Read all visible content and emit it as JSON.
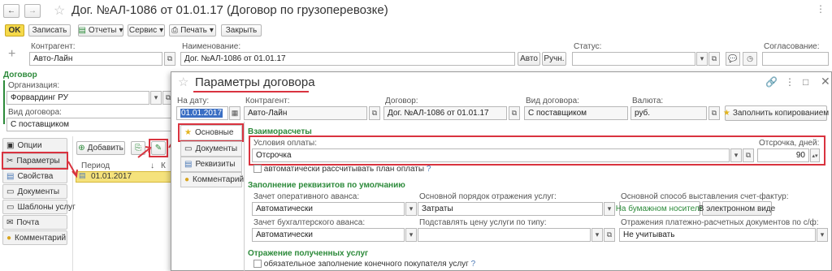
{
  "main": {
    "title": "Дог. №АЛ-1086 от 01.01.17 (Договор по грузоперевозке)",
    "toolbar": {
      "ok": "OK",
      "save": "Записать",
      "reports": "Отчеты",
      "service": "Сервис",
      "print": "Печать",
      "close": "Закрыть"
    },
    "fields": {
      "kontragent_label": "Контрагент:",
      "kontragent": "Авто-Лайн",
      "name_label": "Наименование:",
      "name": "Дог. №АЛ-1086 от 01.01.17",
      "auto": "Авто",
      "manual": "Ручн.",
      "status_label": "Статус:",
      "approval_label": "Согласование:"
    },
    "section_title": "Договор",
    "org_label": "Организация:",
    "org": "Форвардинг РУ",
    "contract_type_label": "Вид договора:",
    "contract_type": "С поставщиком",
    "nav": [
      "Опции",
      "Параметры",
      "Свойства",
      "Документы",
      "Шаблоны услуг",
      "Почта",
      "Комментарий"
    ],
    "grid": {
      "add": "Добавить",
      "col_period": "Период",
      "col_k": "К",
      "row_period": "01.01.2017"
    }
  },
  "dialog": {
    "title": "Параметры договора",
    "date_label": "На дату:",
    "date": "01.01.2017",
    "kontragent_label": "Контрагент:",
    "kontragent": "Авто-Лайн",
    "contract_label": "Договор:",
    "contract": "Дог. №АЛ-1086 от 01.01.17",
    "contract_type_label": "Вид договора:",
    "contract_type": "С поставщиком",
    "currency_label": "Валюта:",
    "currency": "руб.",
    "fill_copy": "Заполнить копированием",
    "tabs": [
      "Основные",
      "Документы",
      "Реквизиты",
      "Комментарий"
    ],
    "settlements": "Взаиморасчеты",
    "pay_terms_label": "Условия оплаты:",
    "pay_terms": "Отсрочка",
    "delay_label": "Отсрочка, дней:",
    "delay": "90",
    "auto_plan": "автоматически рассчитывать план оплаты",
    "defaults": "Заполнение реквизитов по умолчанию",
    "advance_op_label": "Зачет оперативного аванса:",
    "advance_op": "Автоматически",
    "main_order_label": "Основной порядок отражения услуг:",
    "main_order": "Затраты",
    "invoice_label": "Основной способ выставления счет-фактур:",
    "paper": "На бумажном носителе",
    "electronic": "В электронном виде",
    "advance_acc_label": "Зачет бухгалтерского аванса:",
    "advance_acc": "Автоматически",
    "price_type_label": "Подставлять цену услуги по типу:",
    "price_type": "",
    "reflect_label": "Отражения платежно-расчетных документов по с/ф:",
    "reflect": "Не учитывать",
    "received": "Отражение полученных услуг",
    "buyer_check": "обязательное заполнение конечного покупателя услуг"
  },
  "colors": {
    "accent": "#2c8a3a",
    "highlight": "#d9333f",
    "ok": "#f5d94a"
  }
}
